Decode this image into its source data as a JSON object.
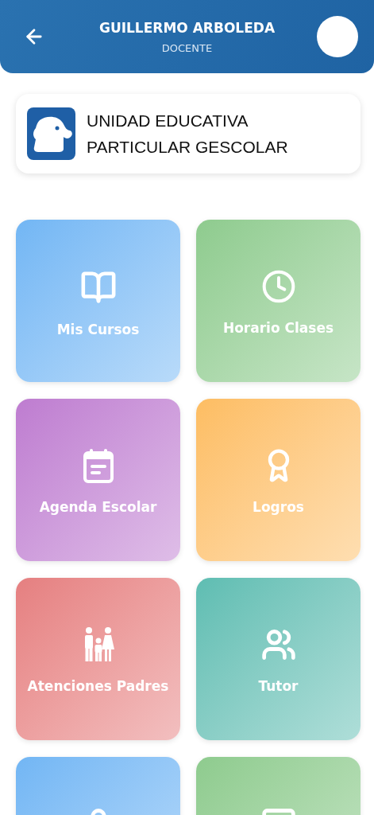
{
  "header": {
    "title": "GUILLERMO ARBOLEDA",
    "subtitle": "DOCENTE"
  },
  "school": {
    "name": "UNIDAD EDUCATIVA PARTICULAR GESCOLAR"
  },
  "tiles": [
    {
      "kind": "courses",
      "label": "Mis Cursos",
      "color": "#72b6f4"
    },
    {
      "kind": "schedule",
      "label": "Horario Clases",
      "color": "#8ecb8e"
    },
    {
      "kind": "agenda",
      "label": "Agenda Escolar",
      "color": "#be7cd0"
    },
    {
      "kind": "achievements",
      "label": "Logros",
      "color": "#fdbd62"
    },
    {
      "kind": "parents",
      "label": "Atenciones Padres",
      "color": "#e57f80"
    },
    {
      "kind": "tutor",
      "label": "Tutor",
      "color": "#5ebdb2"
    },
    {
      "kind": "person",
      "color": "#72b6f4"
    },
    {
      "kind": "message",
      "color": "#8ecb8e"
    }
  ]
}
